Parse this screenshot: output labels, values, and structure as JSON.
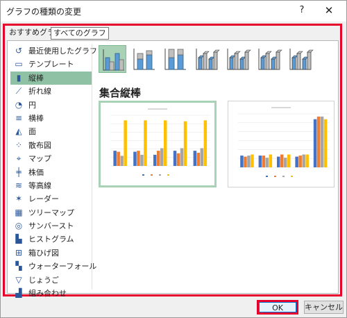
{
  "dialog": {
    "title": "グラフの種類の変更",
    "help_label": "?",
    "close_label": "✕"
  },
  "tabs": [
    "おすすめグラフ",
    "すべてのグラフ"
  ],
  "sidebar": {
    "items": [
      {
        "label": "最近使用したグラフ",
        "icon": "recent-icon",
        "selected": false
      },
      {
        "label": "テンプレート",
        "icon": "folder-icon",
        "selected": false
      },
      {
        "label": "縦棒",
        "icon": "column-chart-icon",
        "selected": true
      },
      {
        "label": "折れ線",
        "icon": "line-chart-icon",
        "selected": false
      },
      {
        "label": "円",
        "icon": "pie-chart-icon",
        "selected": false
      },
      {
        "label": "横棒",
        "icon": "bar-chart-icon",
        "selected": false
      },
      {
        "label": "面",
        "icon": "area-chart-icon",
        "selected": false
      },
      {
        "label": "散布図",
        "icon": "scatter-chart-icon",
        "selected": false
      },
      {
        "label": "マップ",
        "icon": "map-chart-icon",
        "selected": false
      },
      {
        "label": "株価",
        "icon": "stock-chart-icon",
        "selected": false
      },
      {
        "label": "等高線",
        "icon": "surface-chart-icon",
        "selected": false
      },
      {
        "label": "レーダー",
        "icon": "radar-chart-icon",
        "selected": false
      },
      {
        "label": "ツリーマップ",
        "icon": "treemap-chart-icon",
        "selected": false
      },
      {
        "label": "サンバースト",
        "icon": "sunburst-chart-icon",
        "selected": false
      },
      {
        "label": "ヒストグラム",
        "icon": "histogram-chart-icon",
        "selected": false
      },
      {
        "label": "箱ひげ図",
        "icon": "box-whisker-chart-icon",
        "selected": false
      },
      {
        "label": "ウォーターフォール",
        "icon": "waterfall-chart-icon",
        "selected": false
      },
      {
        "label": "じょうご",
        "icon": "funnel-chart-icon",
        "selected": false
      },
      {
        "label": "組み合わせ",
        "icon": "combo-chart-icon",
        "selected": false
      }
    ]
  },
  "subtypes": [
    {
      "icon": "clustered-column-icon",
      "selected": true
    },
    {
      "icon": "stacked-column-icon",
      "selected": false
    },
    {
      "icon": "100-stacked-column-icon",
      "selected": false
    },
    {
      "icon": "3d-clustered-column-icon",
      "selected": false
    },
    {
      "icon": "3d-stacked-column-icon",
      "selected": false
    },
    {
      "icon": "3d-100-stacked-column-icon",
      "selected": false
    },
    {
      "icon": "3d-column-icon",
      "selected": false
    }
  ],
  "section_title": "集合縦棒",
  "colors": {
    "accent_red": "#e8002d",
    "selection_green": "#8fc1a4",
    "series_blue": "#4472c4",
    "series_orange": "#ed7d31",
    "series_gray": "#a5a5a5",
    "series_yellow": "#ffc000"
  },
  "buttons": {
    "ok": "OK",
    "cancel": "キャンセル"
  }
}
